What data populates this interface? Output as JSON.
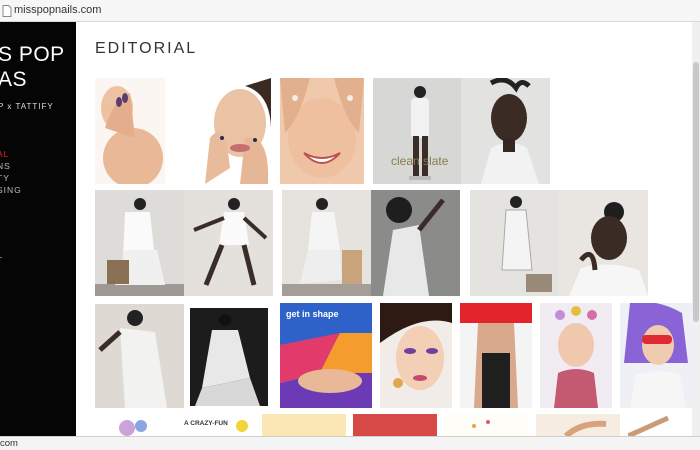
{
  "browser": {
    "url": "misspopnails.com"
  },
  "sidebar": {
    "brand": [
      "S POP",
      "AS"
    ],
    "tagline": "P x TATTIFY",
    "nav": [
      {
        "label": "AL",
        "active": true
      },
      {
        "label": "NS",
        "active": false
      },
      {
        "label": "TY",
        "active": false
      },
      {
        "label": "SING",
        "active": false
      }
    ],
    "nav_extra": [
      "",
      "T"
    ]
  },
  "page": {
    "title": "EDITORIAL"
  },
  "gallery": {
    "captions": {
      "clean_slate": "clean slate",
      "get_in_shape": "get in shape",
      "crazy_fun": "A CRAZY-FUN"
    }
  },
  "status": {
    "text": "com"
  },
  "colors": {
    "accent": "#e0242b",
    "sidebar": "#050505"
  }
}
